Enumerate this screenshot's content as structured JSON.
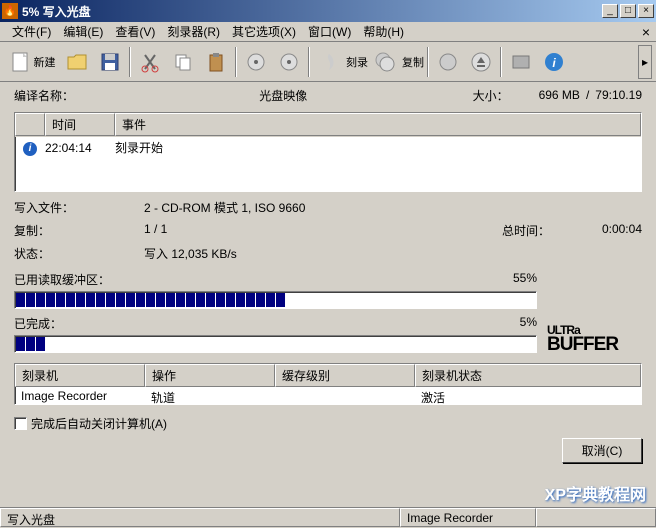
{
  "title": "5% 写入光盘",
  "menu": [
    "文件(F)",
    "编辑(E)",
    "查看(V)",
    "刻录器(R)",
    "其它选项(X)",
    "窗口(W)",
    "帮助(H)"
  ],
  "toolbar": {
    "new": "新建",
    "burn": "刻录",
    "copy": "复制"
  },
  "info": {
    "compile_label": "编译名称：",
    "image_label": "光盘映像",
    "size_label": "大小：",
    "size_value": "696 MB",
    "duration": "79:10.19"
  },
  "log": {
    "headers": {
      "time": "时间",
      "event": "事件"
    },
    "rows": [
      {
        "time": "22:04:14",
        "event": "刻录开始"
      }
    ]
  },
  "details": {
    "write_file_label": "写入文件：",
    "write_file_value": "2 - CD-ROM 模式 1, ISO 9660",
    "copy_label": "复制：",
    "copy_value": "1 / 1",
    "total_time_label": "总时间：",
    "total_time_value": "0:00:04",
    "status_label": "状态：",
    "status_value": "写入 12,035 KB/s"
  },
  "buffer": {
    "label": "已用读取缓冲区：",
    "percent": "55%"
  },
  "complete": {
    "label": "已完成：",
    "percent": "5%"
  },
  "table": {
    "headers": [
      "刻录机",
      "操作",
      "缓存级别",
      "刻录机状态"
    ],
    "rows": [
      {
        "recorder": "Image Recorder",
        "action": "轨道",
        "cache": "",
        "status": "激活"
      }
    ]
  },
  "shutdown_checkbox": "完成后自动关闭计算机(A)",
  "cancel_btn": "取消(C)",
  "status": {
    "left": "写入光盘",
    "center": "Image Recorder"
  },
  "watermark": "XP字典教程网"
}
